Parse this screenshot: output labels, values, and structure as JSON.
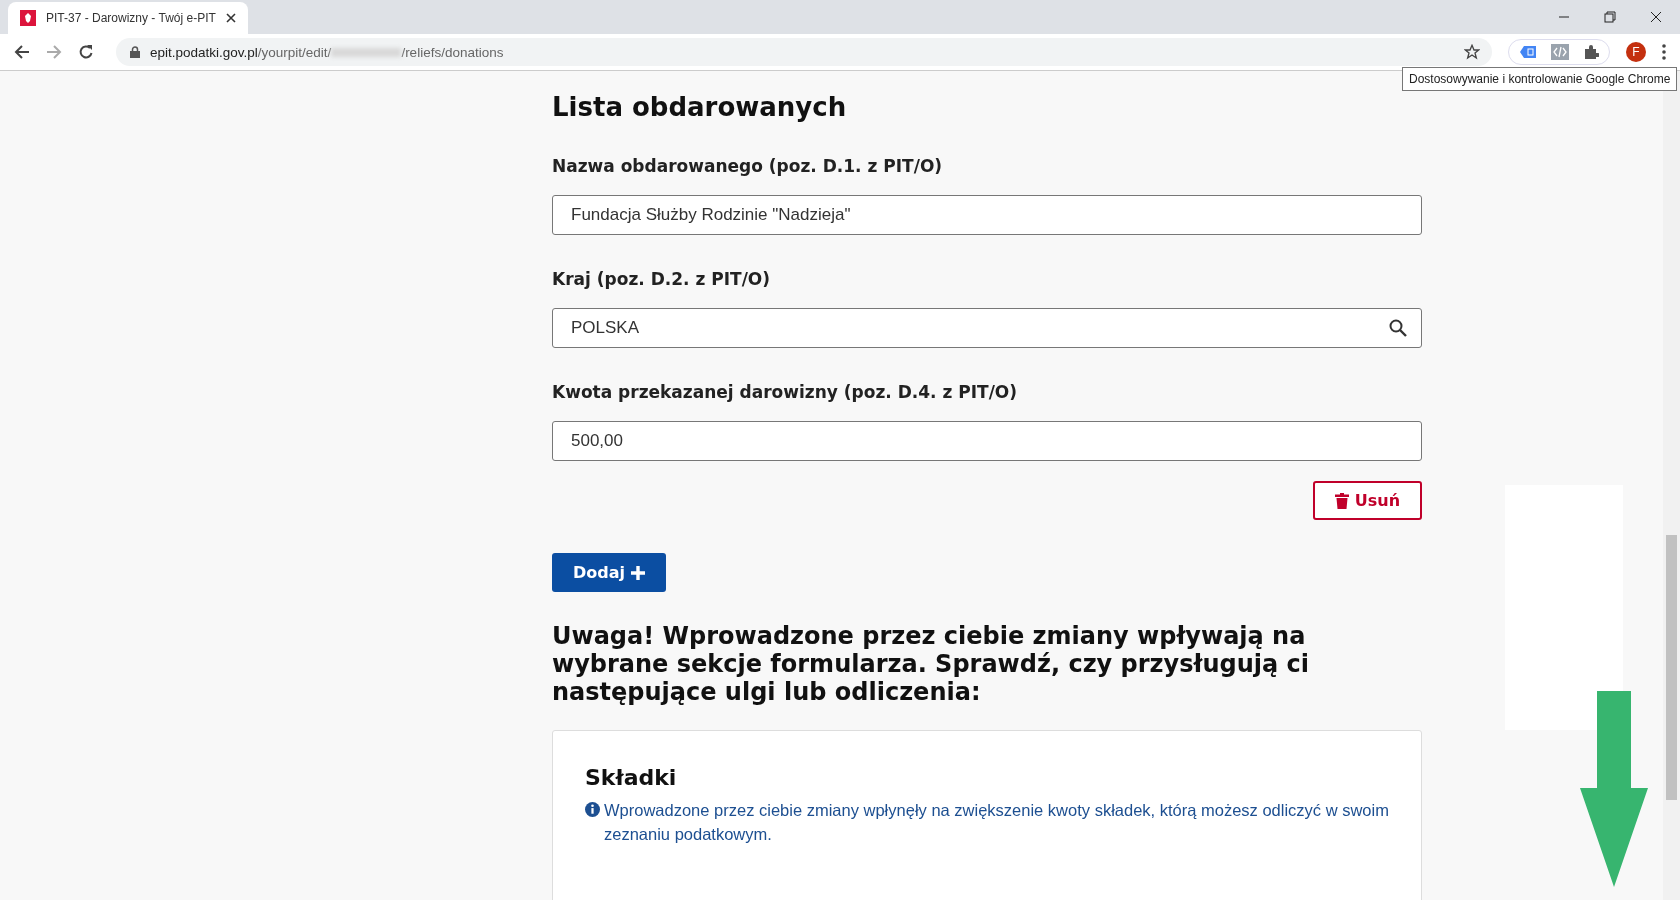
{
  "browser": {
    "tab": {
      "title": "PIT-37 - Darowizny - Twój e-PIT",
      "selected": true
    },
    "url": {
      "host": "epit.podatki.gov.pl",
      "path_before": "/yourpit/edit/",
      "path_after": "/reliefs/donations"
    },
    "profile_initial": "F",
    "tooltip": "Dostosowywanie i kontrolowanie Google Chrome"
  },
  "page": {
    "title": "Lista obdarowanych",
    "fields": [
      {
        "kind": "text",
        "label": "Nazwa obdarowanego (poz. D.1. z PIT/O)",
        "value": "Fundacja Służby Rodzinie \"Nadzieja\""
      },
      {
        "kind": "search",
        "label": "Kraj (poz. D.2. z PIT/O)",
        "value": "POLSKA"
      },
      {
        "kind": "text",
        "label": "Kwota przekazanej darowizny (poz. D.4. z PIT/O)",
        "value": "500,00"
      }
    ],
    "remove_button": "Usuń",
    "add_button": "Dodaj",
    "warning": "Uwaga! Wprowadzone przez ciebie zmiany wpływają na wybrane sekcje formularza. Sprawdź, czy przysługują ci następujące ulgi lub odliczenia:",
    "card": {
      "title": "Składki",
      "info": "Wprowadzone przez ciebie zmiany wpłynęły na zwiększenie kwoty składek, którą możesz odliczyć w swoim zeznaniu podatkowym."
    }
  }
}
